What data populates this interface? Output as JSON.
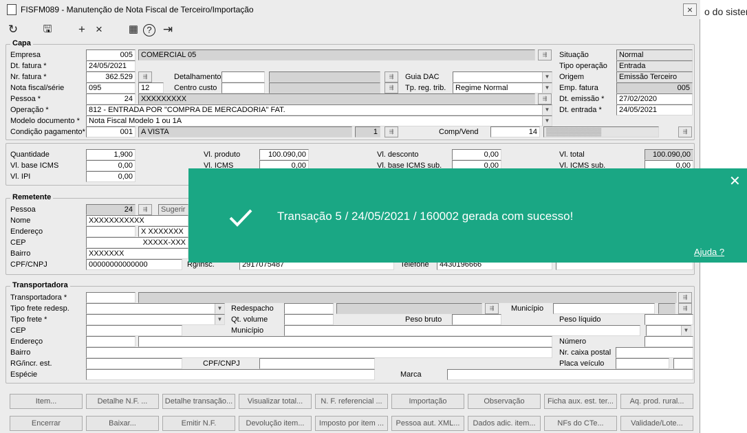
{
  "window": {
    "title": "FISFM089 - Manutenção de Nota Fiscal de Terceiro/Importação",
    "close": "×"
  },
  "background_text": "o do sister",
  "toolbar": {
    "refresh": "↻",
    "save": "🖫",
    "add": "+",
    "cancel": "×",
    "calendar": "▦",
    "help": "?",
    "exit": "⇥"
  },
  "capa": {
    "title": "Capa",
    "empresa": {
      "label": "Empresa",
      "code": "005",
      "name": "COMERCIAL 05"
    },
    "dt_fatura": {
      "label": "Dt. fatura *",
      "value": "24/05/2021"
    },
    "nr_fatura": {
      "label": "Nr. fatura *",
      "value": "362.529"
    },
    "nota_fiscal": {
      "label": "Nota fiscal/série",
      "value": "095",
      "serie": "12"
    },
    "pessoa": {
      "label": "Pessoa *",
      "code": "24",
      "name": "XXXXXXXXX"
    },
    "operacao": {
      "label": "Operação *",
      "value": "812 - ENTRADA POR \"COMPRA DE MERCADORIA\" FAT."
    },
    "modelo": {
      "label": "Modelo documento *",
      "value": "Nota Fiscal Modelo 1 ou 1A"
    },
    "condicao": {
      "label": "Condição pagamento*",
      "code": "001",
      "name": "A VISTA",
      "parcelas": "1"
    },
    "detalhamento": {
      "label": "Detalhamento"
    },
    "centro_custo": {
      "label": "Centro custo"
    },
    "guia_dac": {
      "label": "Guia DAC"
    },
    "tp_reg": {
      "label": "Tp. reg. trib.",
      "value": "Regime Normal"
    },
    "comp_vend": {
      "label": "Comp/Vend",
      "value": "14"
    },
    "situacao": {
      "label": "Situação",
      "value": "Normal"
    },
    "tipo_operacao": {
      "label": "Tipo operação",
      "value": "Entrada"
    },
    "origem": {
      "label": "Origem",
      "value": "Emissão Terceiro"
    },
    "emp_fatura": {
      "label": "Emp. fatura",
      "value": "005"
    },
    "dt_emissao": {
      "label": "Dt. emissão *",
      "value": "27/02/2020"
    },
    "dt_entrada": {
      "label": "Dt. entrada *",
      "value": "24/05/2021"
    }
  },
  "valores": {
    "quantidade": {
      "label": "Quantidade",
      "value": "1,900"
    },
    "base_icms": {
      "label": "Vl. base ICMS",
      "value": "0,00"
    },
    "ipi": {
      "label": "Vl. IPI",
      "value": "0,00"
    },
    "produto": {
      "label": "Vl. produto",
      "value": "100.090,00"
    },
    "icms": {
      "label": "Vl. ICMS",
      "value": "0,00"
    },
    "desconto": {
      "label": "Vl. desconto",
      "value": "0,00"
    },
    "base_icms_sub": {
      "label": "Vl. base ICMS sub.",
      "value": "0,00"
    },
    "total": {
      "label": "Vl. total",
      "value": "100.090,00"
    },
    "icms_sub": {
      "label": "Vl. ICMS sub.",
      "value": "0,00"
    }
  },
  "remetente": {
    "title": "Remetente",
    "pessoa": {
      "label": "Pessoa",
      "value": "24",
      "sugerir": "Sugerir"
    },
    "nome": {
      "label": "Nome",
      "value": "XXXXXXXXXXX"
    },
    "endereco": {
      "label": "Endereço",
      "value": "X XXXXXXX"
    },
    "cep": {
      "label": "CEP",
      "value": "XXXXX-XXX"
    },
    "bairro": {
      "label": "Bairro",
      "value": "XXXXXXX"
    },
    "cpf": {
      "label": "CPF/CNPJ",
      "value": "00000000000000"
    },
    "rg": {
      "label": "Rg/insc.",
      "value": "2917075487"
    },
    "telefone": {
      "label": "Telefone",
      "value": "4430196666"
    }
  },
  "transportadora": {
    "title": "Transportadora",
    "transportadora": "Transportadora *",
    "tipo_frete_redesp": "Tipo frete redesp.",
    "tipo_frete": "Tipo frete *",
    "cep": "CEP",
    "endereco": "Endereço",
    "bairro": "Bairro",
    "rg": "RG/incr. est.",
    "especie": "Espécie",
    "redespacho": "Redespacho",
    "qt_volume": "Qt. volume",
    "municipio": "Município",
    "municipio2": "Município",
    "peso_bruto": "Peso bruto",
    "peso_liquido": "Peso líquido",
    "cpf": "CPF/CNPJ",
    "marca": "Marca",
    "numero": "Número",
    "caixa_postal": "Nr. caixa postal",
    "placa": "Placa veículo"
  },
  "buttons_row1": [
    "Item...",
    "Detalhe N.F. ...",
    "Detalhe transação...",
    "Visualizar total...",
    "N. F. referencial ...",
    "Importação",
    "Observação",
    "Ficha aux. est. ter...",
    "Aq. prod. rural..."
  ],
  "buttons_row2": [
    "Encerrar",
    "Baixar...",
    "Emitir N.F.",
    "Devolução item...",
    "Imposto por item ...",
    "Pessoa aut. XML...",
    "Dados adic. item...",
    "NFs do CTe...",
    "Validade/Lote..."
  ],
  "toast": {
    "message": "Transação 5 / 24/05/2021 / 160002 gerada com sucesso!",
    "help": "Ajuda ?",
    "close": "✕",
    "color": "#1aa784"
  }
}
